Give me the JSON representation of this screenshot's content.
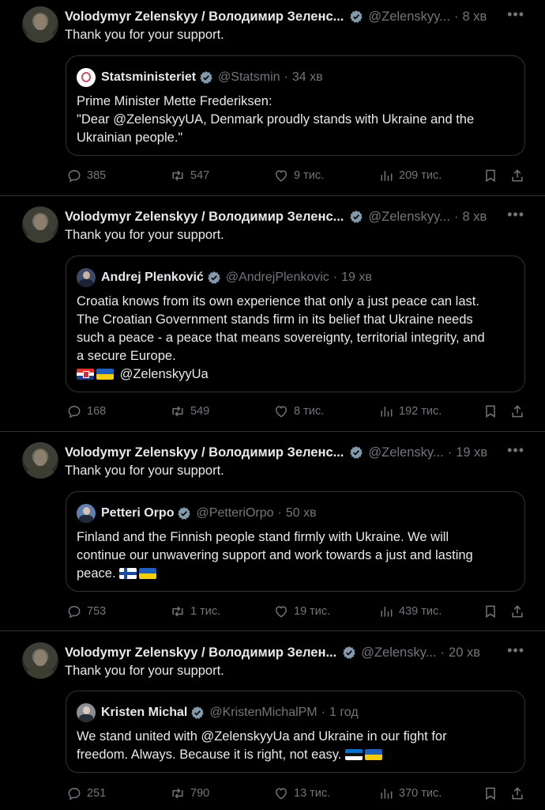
{
  "tweets": [
    {
      "author": "Volodymyr Zelenskyy / Володимир Зеленс...",
      "handle": "@Zelenskyy...",
      "time": "8 хв",
      "text": "Thank you for your support.",
      "quote": {
        "author": "Statsministeriet",
        "handle": "@Statsmin",
        "time": "34 хв",
        "lines": [
          "Prime Minister Mette Frederiksen:",
          "\"Dear @ZelenskyyUA, Denmark proudly stands with Ukraine and the",
          "Ukrainian people.\""
        ]
      },
      "stats": {
        "replies": "385",
        "reposts": "547",
        "likes": "9 тис.",
        "views": "209 тис."
      }
    },
    {
      "author": "Volodymyr Zelenskyy / Володимир Зеленс...",
      "handle": "@Zelenskyy...",
      "time": "8 хв",
      "text": "Thank you for your support.",
      "quote": {
        "author": "Andrej Plenković",
        "handle": "@AndrejPlenkovic",
        "time": "19 хв",
        "lines": [
          "Croatia knows from its own experience that only a just peace can last.",
          "The Croatian Government stands firm in its belief that Ukraine needs",
          "such a peace - a peace that means sovereignty, territorial integrity, and",
          "a secure Europe."
        ],
        "mention": "@ZelenskyyUa"
      },
      "stats": {
        "replies": "168",
        "reposts": "549",
        "likes": "8 тис.",
        "views": "192 тис."
      }
    },
    {
      "author": "Volodymyr Zelenskyy / Володимир Зеленс...",
      "handle": "@Zelensky...",
      "time": "19 хв",
      "text": "Thank you for your support.",
      "quote": {
        "author": "Petteri Orpo",
        "handle": "@PetteriOrpo",
        "time": "50 хв",
        "lines": [
          "Finland and the Finnish people stand firmly with Ukraine. We will",
          "continue our unwavering support and work towards a just and lasting",
          "peace."
        ]
      },
      "stats": {
        "replies": "753",
        "reposts": "1 тис.",
        "likes": "19 тис.",
        "views": "439 тис."
      }
    },
    {
      "author": "Volodymyr Zelenskyy / Володимир Зелен...",
      "handle": "@Zelensky...",
      "time": "20 хв",
      "text": "Thank you for your support.",
      "quote": {
        "author": "Kristen Michal",
        "handle": "@KristenMichalPM",
        "time": "1 год",
        "lines": [
          "We stand united with @ZelenskyyUa and Ukraine in our fight for",
          "freedom. Always. Because it is right, not easy."
        ]
      },
      "stats": {
        "replies": "251",
        "reposts": "790",
        "likes": "13 тис.",
        "views": "370 тис."
      }
    }
  ],
  "colors": {
    "background": "#000000",
    "text": "#e7e9ea",
    "muted": "#71767b",
    "verified": "#829aab",
    "border": "#2f3336"
  },
  "icons": [
    "verified-badge-icon",
    "more-icon",
    "reply-icon",
    "repost-icon",
    "like-icon",
    "views-icon",
    "bookmark-icon",
    "share-icon"
  ]
}
